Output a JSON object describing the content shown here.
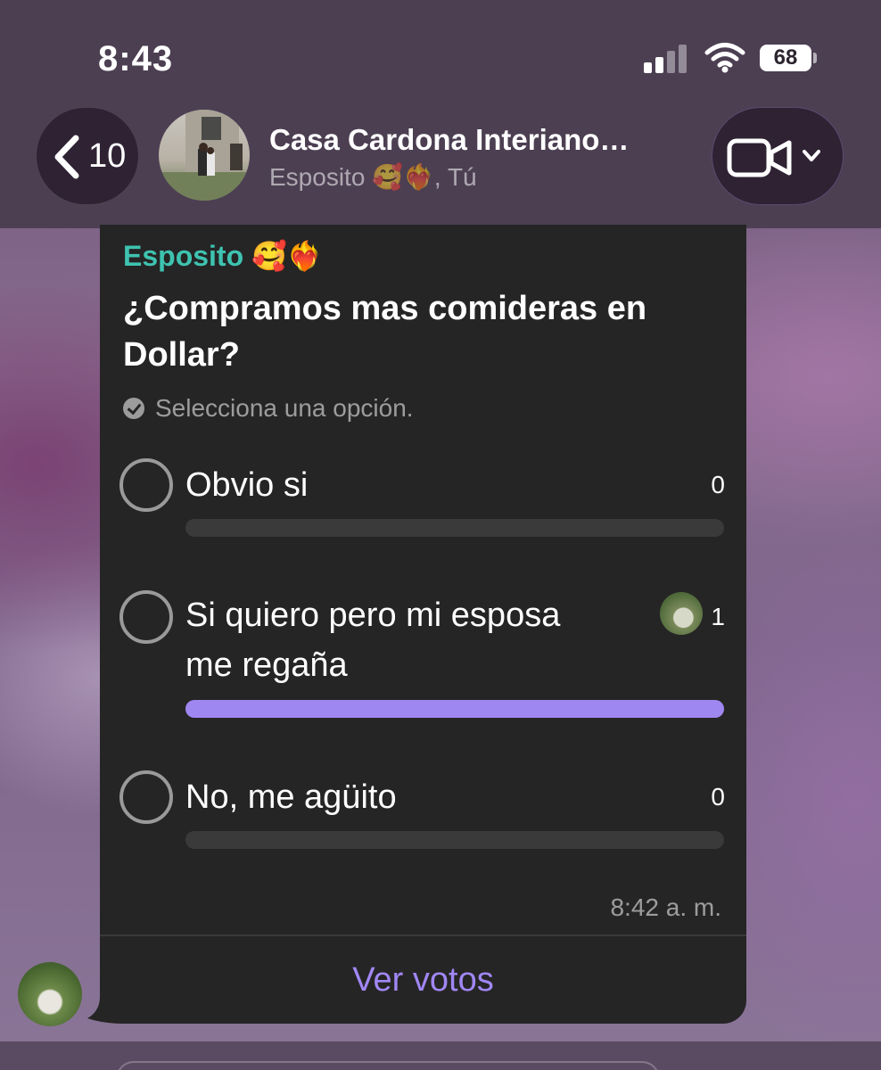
{
  "status_bar": {
    "time": "8:43",
    "battery": "68"
  },
  "header": {
    "back_count": "10",
    "title": "Casa Cardona Interiano…",
    "subtitle": "Esposito 🥰❤️‍🔥, Tú",
    "icons": [
      "chevron-left-icon",
      "video-camera-icon",
      "chevron-down-icon"
    ]
  },
  "poll": {
    "sender": "Esposito 🥰❤️‍🔥",
    "sender_color": "#3ec3b0",
    "question": "¿Compramos mas comideras en Dollar?",
    "hint": "Selecciona una opción.",
    "accent_color": "#9f87f2",
    "options": [
      {
        "label": "Obvio si",
        "count": "0",
        "fraction": 0
      },
      {
        "label": "Si quiero pero mi esposa me regaña",
        "count": "1",
        "fraction": 1
      },
      {
        "label": "No, me agüito",
        "count": "0",
        "fraction": 0
      }
    ],
    "timestamp": "8:42 a. m.",
    "view_votes": "Ver votos"
  }
}
